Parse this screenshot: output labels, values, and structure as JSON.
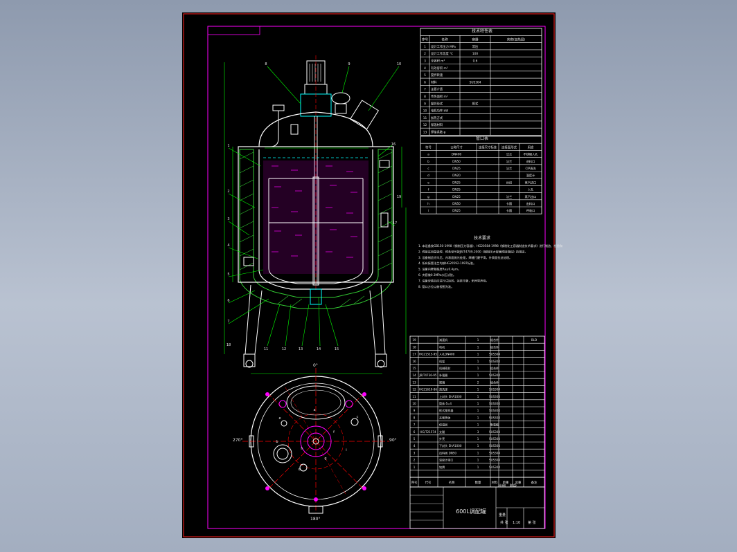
{
  "colors": {
    "background": "#8e9aae",
    "sheet": "#000000",
    "frame": "#ff00ff",
    "outline": "#ffffff",
    "dimension": "#00ff00",
    "centerline": "#ff0000",
    "insulation": "#33cc33",
    "liquid": "#ff00ff",
    "water": "#00ffff"
  },
  "title_block": {
    "drawing_title": "600L调配罐",
    "scale_value": "1:10",
    "weight_label": "重量",
    "scale_label": "比例",
    "stage_label": "阶段",
    "sheet_label": "第 张",
    "of_label": "共 张"
  },
  "section_titles": {
    "design_table": "技术特性表",
    "nozzle_table": "管口表",
    "notes": "技术要求"
  },
  "design_table": {
    "header": [
      "序号",
      "名称",
      "容器",
      "夹套(加热层)"
    ],
    "rows": [
      [
        "1",
        "设计工作压力 MPa",
        "常压",
        ""
      ],
      [
        "2",
        "设计工作温度 ℃",
        "100",
        ""
      ],
      [
        "3",
        "全容积 m³",
        "0.6",
        ""
      ],
      [
        "4",
        "有效容积 m³",
        "",
        ""
      ],
      [
        "5",
        "搅拌转速",
        "",
        ""
      ],
      [
        "6",
        "材料",
        "SUS304",
        ""
      ],
      [
        "7",
        "主要介质",
        "",
        ""
      ],
      [
        "8",
        "传热面积 m²",
        "",
        ""
      ],
      [
        "9",
        "搅拌形式",
        "框式",
        ""
      ],
      [
        "10",
        "电机功率 kW",
        "",
        ""
      ],
      [
        "11",
        "加热方式",
        "",
        ""
      ],
      [
        "12",
        "保温材料",
        "",
        ""
      ],
      [
        "13",
        "焊接系数 φ",
        "",
        ""
      ]
    ]
  },
  "nozzle_table": {
    "header": [
      "符号",
      "公称尺寸",
      "连接尺寸标准",
      "连接面形式",
      "用途"
    ],
    "rows": [
      [
        "a",
        "DN400",
        "",
        "法兰",
        "不锈钢人孔"
      ],
      [
        "b",
        "DN50",
        "",
        "法兰",
        "进料口"
      ],
      [
        "c",
        "DN25",
        "",
        "法兰",
        "CIP清洗"
      ],
      [
        "d",
        "DN20",
        "",
        "",
        "温度计"
      ],
      [
        "e",
        "DN25",
        "",
        "丝扣",
        "蒸汽进口"
      ],
      [
        "f",
        "DN25",
        "",
        "",
        "人孔"
      ],
      [
        "g",
        "DN25",
        "",
        "法兰",
        "蒸汽出口"
      ],
      [
        "h",
        "DN50",
        "",
        "卡箍",
        "出料口"
      ],
      [
        "i",
        "DN25",
        "",
        "卡箍",
        "呼吸口"
      ]
    ]
  },
  "notes": [
    "1. 本设备按GB150-1998《钢制压力容器》、HG20584-1998《钢制化工容器制造技术要求》进行制造、检验和验收。",
    "2. 焊接采用氩弧焊，焊条型号按JB/T4709-2000《钢制压力容器焊接规程》的规定。",
    "3. 设备制造完毕后，内表面抛光处理，焊缝打磨平滑，外表面拉丝处理。",
    "4. 所有接管法兰均按HG20592-1997标准。",
    "5. 设备内壁粗糙度Ra≤0.4μm。",
    "6. 夹套做0.3MPa水压试验。",
    "7. 设备安装后应进行试运转，运转平稳，无异常声响。",
    "8. 管口方位以俯视图为准。"
  ],
  "parts_table": {
    "header": [
      "序号",
      "代号",
      "名称",
      "数量",
      "材料",
      "单重",
      "总重",
      "备注"
    ],
    "rows": [
      [
        "19",
        "",
        "减速机",
        "1",
        "组合件",
        "",
        "",
        "BLD"
      ],
      [
        "18",
        "",
        "电机",
        "1",
        "组合件",
        "",
        "",
        ""
      ],
      [
        "17",
        "HG21515-95",
        "人孔DN400",
        "1",
        "SUS304",
        "",
        "",
        ""
      ],
      [
        "16",
        "",
        "机架",
        "1",
        "SUS304",
        "",
        "",
        ""
      ],
      [
        "15",
        "",
        "机械密封",
        "1",
        "组合件",
        "",
        "",
        ""
      ],
      [
        "14",
        "JB/T4736-95",
        "补强圈",
        "1",
        "SUS304",
        "",
        "",
        ""
      ],
      [
        "13",
        "",
        "视镜",
        "2",
        "组合件",
        "",
        "",
        ""
      ],
      [
        "12",
        "HG21619-86",
        "清洗球",
        "1",
        "SUS304",
        "",
        "",
        ""
      ],
      [
        "11",
        "",
        "上封头 EHA1000",
        "1",
        "SUS304",
        "",
        "",
        ""
      ],
      [
        "10",
        "",
        "筒体 δ=4",
        "1",
        "SUS304",
        "",
        "",
        ""
      ],
      [
        "9",
        "",
        "框式搅拌器",
        "1",
        "SUS304",
        "",
        "",
        ""
      ],
      [
        "8",
        "",
        "夹套筒体",
        "1",
        "SUS304",
        "",
        "",
        ""
      ],
      [
        "7",
        "",
        "保温层",
        "1",
        "聚氨酯",
        "",
        "",
        ""
      ],
      [
        "6",
        "HG/T21574",
        "支腿",
        "3",
        "SUS304",
        "",
        "",
        ""
      ],
      [
        "5",
        "",
        "外壳",
        "1",
        "SUS304",
        "",
        "",
        ""
      ],
      [
        "4",
        "",
        "下封头 EHA1000",
        "1",
        "SUS304",
        "",
        "",
        ""
      ],
      [
        "3",
        "",
        "出料阀 DN50",
        "1",
        "SUS304",
        "",
        "",
        ""
      ],
      [
        "2",
        "",
        "温度计接口",
        "1",
        "SUS304",
        "",
        "",
        ""
      ],
      [
        "1",
        "",
        "铭牌",
        "1",
        "SUS304",
        "",
        "",
        ""
      ]
    ]
  },
  "callouts": [
    "1",
    "2",
    "3",
    "4",
    "5",
    "6",
    "7",
    "8",
    "9",
    "10",
    "11",
    "12",
    "13",
    "14",
    "15",
    "16",
    "17",
    "18",
    "19"
  ],
  "plan_labels": {
    "angle_top": "0°",
    "angle_left": "270°",
    "angle_right": "90°",
    "angle_bottom": "180°",
    "nozzle_letters": [
      "a",
      "b",
      "c",
      "d",
      "e",
      "f",
      "g",
      "h",
      "i"
    ]
  }
}
